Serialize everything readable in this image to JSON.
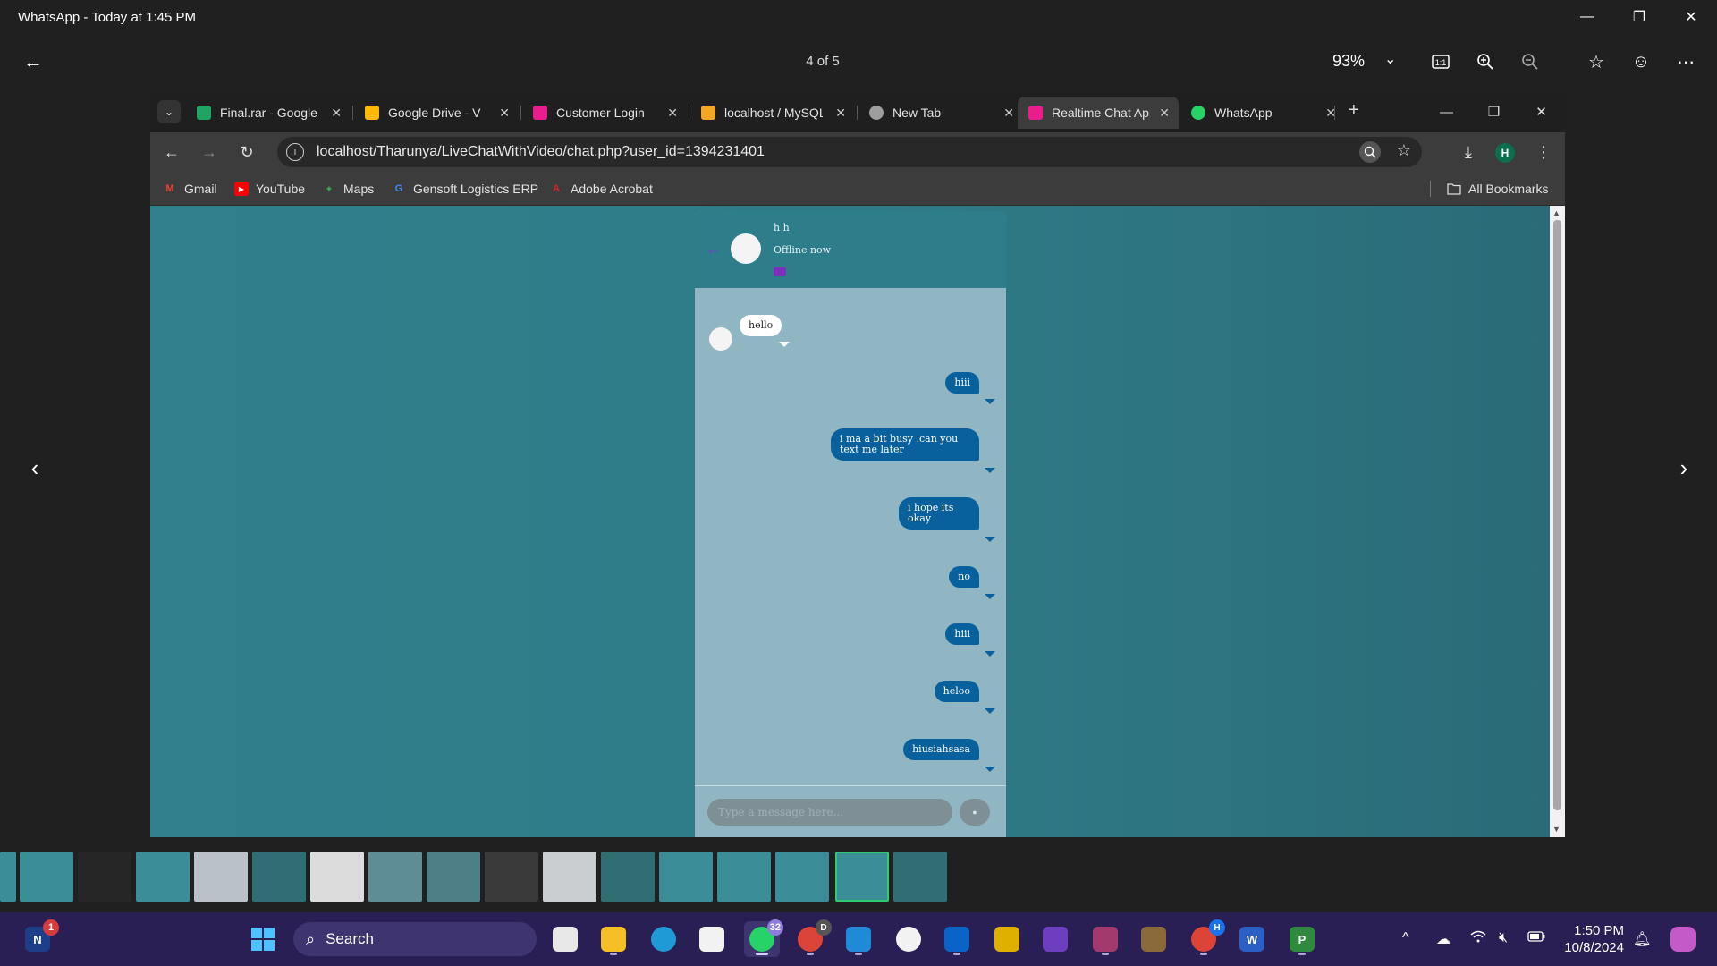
{
  "window": {
    "title": "WhatsApp - Today at 1:45 PM",
    "minimize": "—",
    "restore": "❐",
    "close": "✕"
  },
  "viewer": {
    "counter": "4 of 5",
    "zoom": "93%",
    "zoom_dropdown": "⌄",
    "icons": [
      "back-arrow-icon",
      "actual-size-icon",
      "zoom-in-icon",
      "zoom-out-icon",
      "favorite-star-icon",
      "feedback-smiley-icon",
      "more-icon"
    ],
    "prev": "‹",
    "next": "›"
  },
  "browser": {
    "tabs": [
      {
        "label": "Final.rar - Google",
        "favicon_color": "#1fa463"
      },
      {
        "label": "Google Drive - V",
        "favicon_color": "#ffba00"
      },
      {
        "label": "Customer Login",
        "favicon_color": "#e91e8c"
      },
      {
        "label": "localhost / MySQL",
        "favicon_color": "#f5a623"
      },
      {
        "label": "New Tab",
        "favicon_color": "#9e9e9e"
      },
      {
        "label": "Realtime Chat App",
        "favicon_color": "#e91e8c",
        "active": true
      },
      {
        "label": "WhatsApp",
        "favicon_color": "#25d366"
      }
    ],
    "tab_close": "✕",
    "new_tab": "+",
    "tab_dropdown": "⌄",
    "url": "localhost/Tharunya/LiveChatWithVideo/chat.php?user_id=1394231401",
    "info_icon": "i",
    "profile_initial": "H",
    "bookmarks": [
      {
        "label": "Gmail",
        "icon": "M",
        "color": "#ea4335"
      },
      {
        "label": "YouTube",
        "icon": "▶",
        "color": "#ff0000"
      },
      {
        "label": "Maps",
        "icon": "✦",
        "color": "#34a853"
      },
      {
        "label": "Gensoft Logistics ERP",
        "icon": "G",
        "color": "#4285f4"
      },
      {
        "label": "Adobe Acrobat",
        "icon": "A",
        "color": "#d4232a"
      }
    ],
    "all_bookmarks": "All Bookmarks"
  },
  "chat": {
    "user_name": "h h",
    "status": "Offline now",
    "incoming": [
      {
        "text": "hello"
      }
    ],
    "outgoing": [
      {
        "text": "hiii"
      },
      {
        "text": "i ma a bit busy .can you text me later"
      },
      {
        "text": "i hope its okay"
      },
      {
        "text": "no"
      },
      {
        "text": "hiii"
      },
      {
        "text": "heloo"
      },
      {
        "text": "hiusiahsasa"
      }
    ],
    "input_placeholder": "Type a message here..."
  },
  "taskbar": {
    "search_label": "Search",
    "whatsapp_badge": "32",
    "nfl_badge": "1",
    "chrome_badge": "D",
    "chrome2_badge": "H",
    "time": "1:50 PM",
    "date": "10/8/2024"
  }
}
